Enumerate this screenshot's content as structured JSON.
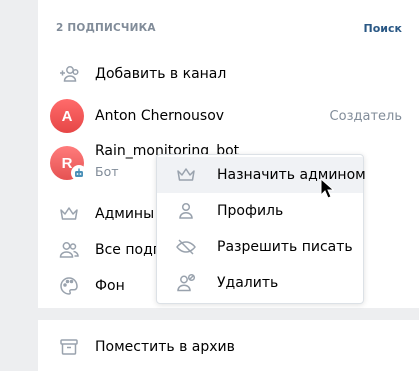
{
  "members_section": {
    "title": "2 ПОДПИСЧИКА",
    "search_label": "Поиск"
  },
  "add_to_channel": {
    "label": "Добавить в канал",
    "icon": "add-user-icon"
  },
  "members": [
    {
      "avatar_letter": "A",
      "name": "Anton Chernousov",
      "role": "Создатель"
    },
    {
      "avatar_letter": "R",
      "name": "Rain_monitoring_bot",
      "subtitle": "Бот"
    }
  ],
  "settings": [
    {
      "label": "Админы",
      "icon": "crown-icon"
    },
    {
      "label": "Все подписчики",
      "icon": "users-icon"
    },
    {
      "label": "Фон",
      "icon": "palette-icon"
    }
  ],
  "archive": {
    "label": "Поместить в архив",
    "icon": "archive-icon"
  },
  "context_menu": {
    "items": [
      {
        "label": "Назначить админом",
        "icon": "crown-icon"
      },
      {
        "label": "Профиль",
        "icon": "user-icon"
      },
      {
        "label": "Разрешить писать",
        "icon": "eye-off-icon"
      },
      {
        "label": "Удалить",
        "icon": "remove-user-icon"
      }
    ]
  },
  "colors": {
    "accent": "#2a5885",
    "muted": "#818c99",
    "icon": "#99a2ad",
    "avatar_red": "#e64646"
  }
}
